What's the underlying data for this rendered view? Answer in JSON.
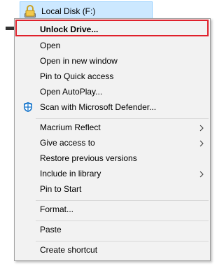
{
  "drive": {
    "label": "Local Disk (F:)",
    "icon": "locked-drive-icon"
  },
  "colors": {
    "menu_background": "#f2f2f2",
    "selection_background": "#cce8ff",
    "highlight_border": "#e0202b",
    "defender_icon": "#0b6fc9"
  },
  "menu": {
    "items": [
      {
        "label": "Unlock Drive...",
        "bold": true,
        "submenu": false
      },
      {
        "label": "Open",
        "submenu": false
      },
      {
        "label": "Open in new window",
        "submenu": false
      },
      {
        "label": "Pin to Quick access",
        "submenu": false
      },
      {
        "label": "Open AutoPlay...",
        "submenu": false
      },
      {
        "label": "Scan with Microsoft Defender...",
        "icon": "windows-defender-shield-icon",
        "submenu": false
      },
      {
        "label": "Macrium Reflect",
        "submenu": true
      },
      {
        "label": "Give access to",
        "submenu": true
      },
      {
        "label": "Restore previous versions",
        "submenu": false
      },
      {
        "label": "Include in library",
        "submenu": true
      },
      {
        "label": "Pin to Start",
        "submenu": false
      },
      {
        "label": "Format...",
        "submenu": false
      },
      {
        "label": "Paste",
        "submenu": false
      },
      {
        "label": "Create shortcut",
        "submenu": false
      }
    ]
  }
}
